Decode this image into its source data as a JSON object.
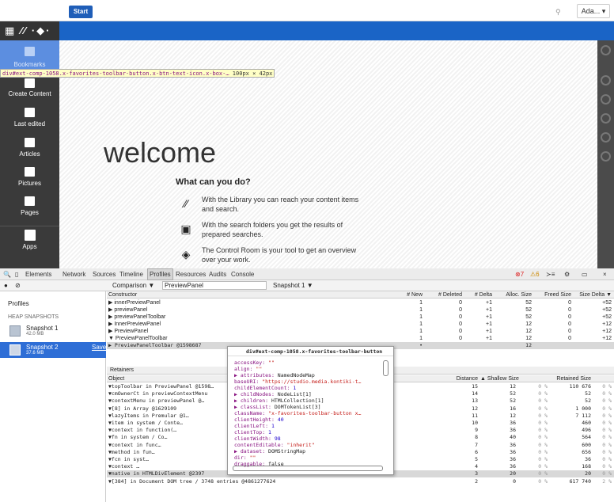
{
  "topbar": {
    "start_label": "Start",
    "user_label": "Ada... ▾",
    "help_glyph": "⚲"
  },
  "appbar": {
    "logo_glyphs": "▦ ⁄⁄ ·◆·"
  },
  "sidebar": {
    "items": [
      {
        "label": "Bookmarks",
        "icon": "bookmark-icon"
      },
      {
        "label": "Create Content",
        "icon": "create-icon"
      },
      {
        "label": "Last edited",
        "icon": "folder-search-icon"
      },
      {
        "label": "Articles",
        "icon": "folder-search-icon"
      },
      {
        "label": "Pictures",
        "icon": "folder-search-icon"
      },
      {
        "label": "Pages",
        "icon": "folder-search-icon"
      },
      {
        "label": "Apps",
        "icon": "apps-icon"
      }
    ]
  },
  "inspect_tooltip": {
    "selector": "div#ext-comp-1058.x-favorites-toolbar-button.x-btn-text-icon.x-box-…",
    "size": "100px × 42px"
  },
  "welcome": {
    "title": "welcome",
    "subtitle": "What can you do?",
    "features": [
      {
        "icon": "library-icon",
        "text": "With the Library you can reach your content items and search."
      },
      {
        "icon": "search-folder-icon",
        "text": "With the search folders you get the results of prepared searches."
      },
      {
        "icon": "control-room-icon",
        "text": "The Control Room is your tool to get an overview over your work."
      }
    ]
  },
  "devtools": {
    "tabs": [
      "Elements",
      "Network",
      "Sources",
      "Timeline",
      "Profiles",
      "Resources",
      "Audits",
      "Console"
    ],
    "active_tab": "Profiles",
    "status": {
      "errors": "7",
      "warnings": "6"
    },
    "toolbar": {
      "comparison_label": "Comparison ▼",
      "filter_value": "PreviewPanel",
      "snapshot_select": "Snapshot 1 ▼"
    },
    "sidebar": {
      "heading": "Profiles",
      "section": "HEAP SNAPSHOTS",
      "snapshots": [
        {
          "name": "Snapshot 1",
          "size": "42.0 MB"
        },
        {
          "name": "Snapshot 2",
          "size": "37.6 MB",
          "action": "Save"
        }
      ]
    },
    "constructor_table": {
      "headers": [
        "Constructor",
        "# New",
        "# Deleted",
        "# Delta",
        "Alloc. Size",
        "Freed Size",
        "Size Delta ▼"
      ],
      "rows": [
        [
          "▶ innerPreviewPanel",
          "1",
          "0",
          "+1",
          "52",
          "0",
          "+52"
        ],
        [
          "▶ previewPanel",
          "1",
          "0",
          "+1",
          "52",
          "0",
          "+52"
        ],
        [
          "▶ previewPanelToolbar",
          "1",
          "0",
          "+1",
          "52",
          "0",
          "+52"
        ],
        [
          "▶ InnerPreviewPanel",
          "1",
          "0",
          "+1",
          "12",
          "0",
          "+12"
        ],
        [
          "▶ PreviewPanel",
          "1",
          "0",
          "+1",
          "12",
          "0",
          "+12"
        ],
        [
          "▼ PreviewPanelToolbar",
          "1",
          "0",
          "+1",
          "12",
          "0",
          "+12"
        ],
        [
          "   ▶ PreviewPanelToolbar @1598687",
          "•",
          "",
          "",
          "12",
          "",
          ""
        ]
      ]
    },
    "retainers": {
      "title": "Retainers",
      "headers": [
        "Object",
        "Distance",
        "▲ Shallow Size",
        "",
        "Retained Size",
        ""
      ],
      "rows": [
        [
          "▼topToolbar in PreviewPanel @1598…",
          "15",
          "12",
          "0 %",
          "110 676",
          "0 %"
        ],
        [
          "  ▼cmOwnerCt in previewContextMenu",
          "14",
          "52",
          "0 %",
          "52",
          "0 %"
        ],
        [
          "    ▼contextMenu in previewPanel @…",
          "13",
          "52",
          "0 %",
          "52",
          "0 %"
        ],
        [
          "      ▼[8] in Array @1629109",
          "12",
          "16",
          "0 %",
          "1 000",
          "0 %"
        ],
        [
          "        ▼lazyItems in Premular @1…",
          "11",
          "12",
          "0 %",
          "7 112",
          "0 %"
        ],
        [
          "          ▼item in system / Conte…",
          "10",
          "36",
          "0 %",
          "460",
          "0 %"
        ],
        [
          "            ▼context in function(…",
          "9",
          "36",
          "0 %",
          "496",
          "0 %"
        ],
        [
          "              ▼fn in system / Co…",
          "8",
          "40",
          "0 %",
          "564",
          "0 %"
        ],
        [
          "                ▼context in func…",
          "7",
          "36",
          "0 %",
          "600",
          "0 %"
        ],
        [
          "                  ▼method in fun…",
          "6",
          "36",
          "0 %",
          "656",
          "0 %"
        ],
        [
          "                    ▼fcn in syst…",
          "5",
          "36",
          "0 %",
          "36",
          "0 %"
        ],
        [
          "                      ▼context …",
          "4",
          "36",
          "0 %",
          "168",
          "0 %"
        ],
        [
          "                        ▼native in HTMLDivElement @2397",
          "3",
          "20",
          "0 %",
          "20",
          "0 %"
        ],
        [
          "                          ▼[384] in Document DOM tree / 3748 entries @4861277624",
          "2",
          "0",
          "0 %",
          "617 740",
          "2 %"
        ]
      ]
    },
    "popup": {
      "title": "div#ext-comp-1058.x-favorites-toolbar-button",
      "props": [
        [
          "accessKey",
          "\"\""
        ],
        [
          "align",
          "\"\""
        ],
        [
          "▶ attributes",
          "NamedNodeMap"
        ],
        [
          "baseURI",
          "\"https://studio.media.kontiki-t…"
        ],
        [
          "childElementCount",
          "1"
        ],
        [
          "▶ childNodes",
          "NodeList[1]"
        ],
        [
          "▶ children",
          "HTMLCollection[1]"
        ],
        [
          "▶ classList",
          "DOMTokenList[3]"
        ],
        [
          "className",
          "\"x-favorites-toolbar-button x…"
        ],
        [
          "clientHeight",
          "40"
        ],
        [
          "clientLeft",
          "1"
        ],
        [
          "clientTop",
          "1"
        ],
        [
          "clientWidth",
          "98"
        ],
        [
          "contentEditable",
          "\"inherit\""
        ],
        [
          "▶ dataset",
          "DOMStringMap"
        ],
        [
          "dir",
          "\"\""
        ],
        [
          "draggable",
          "false"
        ]
      ]
    }
  }
}
